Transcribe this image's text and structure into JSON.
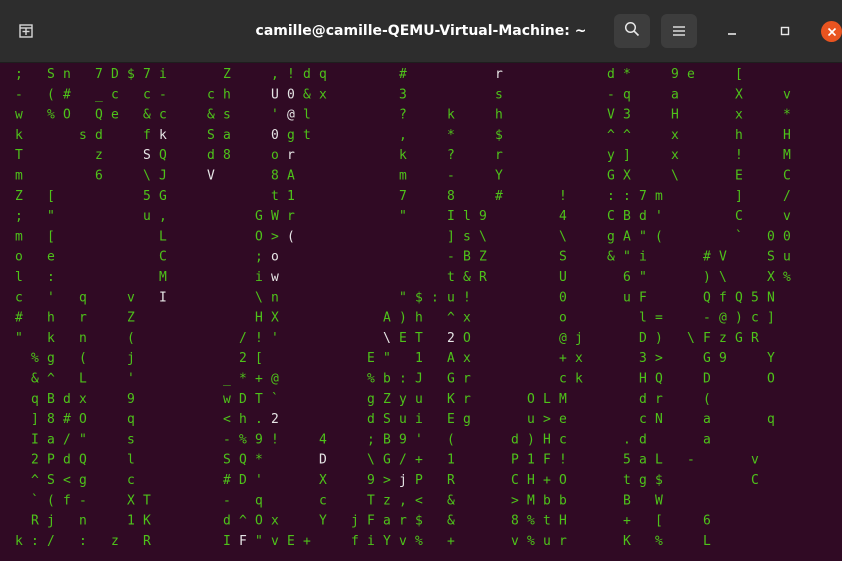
{
  "window": {
    "title": "camille@camille-QEMU-Virtual-Machine: ~"
  },
  "titlebar": {
    "new_tab_icon": "new-tab-icon",
    "search_icon": "search-icon",
    "menu_icon": "hamburger-menu-icon",
    "minimize_icon": "minimize-icon",
    "maximize_icon": "maximize-icon",
    "close_icon": "close-icon"
  },
  "colors": {
    "terminal_bg": "#300a24",
    "rain_green": "#4ec21a",
    "head_white": "#e6e6e6",
    "titlebar_bg": "#2d2d2d",
    "close_orange": "#e95420"
  },
  "terminal": {
    "program": "matrix-rain",
    "rows": [
      " ;   S n   7 D $ 7 i       Z     , ! d q         #           r             d *     9 e     [       ",
      " -   ( #   _ c   c -     c h     U 0 & x         3           s             - q     a       X     v ",
      " w   % O   Q e   & c     & s     ' @ l           ?     k     h             V 3     H       x     * ",
      " k       s d     f k     S a     0 g t           ,     *     $             ^ ^     x       h     H ",
      " T         z     S Q     d 8     o r             k     ?     r             y ]     x       !     M ",
      " m         6     \\ J     V       8 A             m     -     Y             G X     \\       E     C ",
      " Z   [           5 G             t 1             7     8     #       !     : : 7 m         ]     / ",
      " ;   \"           u ,           G W r             \"     I l 9         4     C B d '         C     v ",
      " m   [             L           O > (                   ] s \\         \\     g A \" (         `   0 0 ",
      " o   e             C           ; o                     - B Z         S     & \" i       # V     S u ",
      " l   :             M           i w                     t & R         U       6 \"       ) \\     X % ",
      " c   '   q     v   I           \\ n               \" $ : u !           0       u F       Q f Q 5 N ",
      " #   h   r     Z               H X             A ) h   ^ x           o         l =     - @ ) c ] ",
      " \"   k   n     (             / ! '             \\ E T   2 O           @ j       D )   \\ F z G R   ",
      "   % g   (     j             2 [             E \"   1   A x           + x       3 >     G 9     Y ",
      "   & ^   L     '           _ * + @           % b : J   G r           c k       H Q     D       O ",
      "   q B d x     9           w D T `           g Z y u   K r       O L M         d r     (         ",
      "   ] 8 # O     q           < h . 2           d S u i   E g       u > e         c N     a       q ",
      "   I a / \"     s           - % 9 !     4     ; B 9 '   (       d ) H c       . d       a         ",
      "   2 P d Q     l           S Q *       D     \\ G / +   1       P 1 F !       5 a L   -       v ",
      "   ^ S < g     c           # D '       X     9 > j P   R       C H + O       t g $           C ",
      "   ` ( f -     X T         -   q       c     T z , <   &       > M b b       B   W             ",
      "   R j   n     1 K         d ^ O x     Y   j F a r $   &       8 % t H       +   [     6       ",
      " k : /   :   z   R         I F \" v E +     f i Y v %   +       v % u r       K   %     L       "
    ],
    "bright_cells": [
      [
        0,
        59
      ],
      [
        0,
        61
      ],
      [
        0,
        63
      ],
      [
        1,
        33
      ],
      [
        1,
        35
      ],
      [
        2,
        8
      ],
      [
        2,
        10
      ],
      [
        2,
        35
      ],
      [
        3,
        19
      ],
      [
        3,
        21
      ],
      [
        3,
        33
      ],
      [
        4,
        17
      ],
      [
        4,
        35
      ],
      [
        5,
        21
      ],
      [
        5,
        25
      ],
      [
        7,
        25
      ],
      [
        8,
        35
      ],
      [
        9,
        33
      ],
      [
        10,
        33
      ],
      [
        11,
        19
      ],
      [
        12,
        59
      ],
      [
        13,
        47
      ],
      [
        13,
        55
      ],
      [
        14,
        53
      ],
      [
        17,
        33
      ],
      [
        18,
        35
      ],
      [
        19,
        39
      ],
      [
        19,
        43
      ],
      [
        20,
        49
      ],
      [
        21,
        19
      ],
      [
        21,
        25
      ],
      [
        22,
        13
      ],
      [
        23,
        29
      ]
    ]
  }
}
